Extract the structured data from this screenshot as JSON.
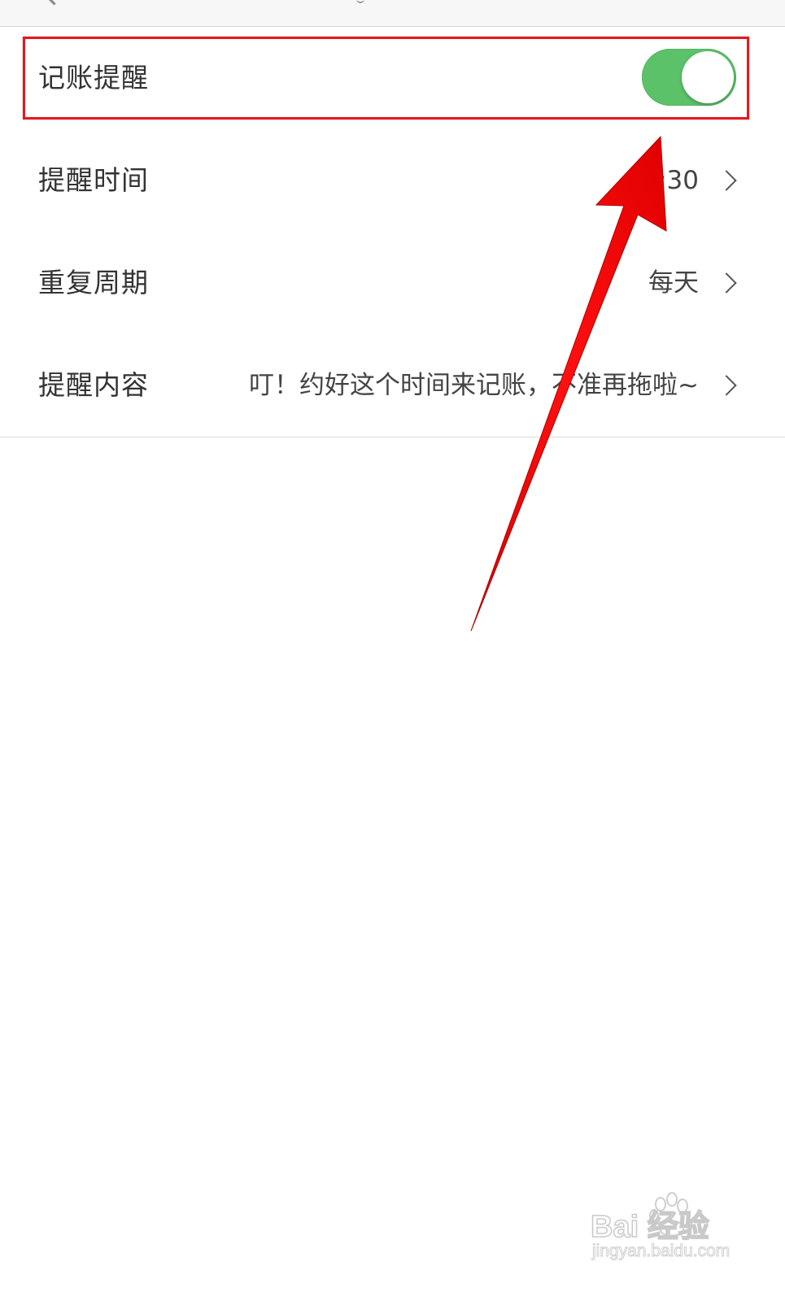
{
  "settings": {
    "rows": [
      {
        "label": "记账提醒",
        "toggle": {
          "on": true,
          "color": "#5cc26a"
        }
      },
      {
        "label": "提醒时间",
        "value": "19:30"
      },
      {
        "label": "重复周期",
        "value": "每天"
      },
      {
        "label": "提醒内容",
        "value": "叮！约好这个时间来记账，不准再拖啦~"
      }
    ]
  },
  "annotation": {
    "highlight_color": "#e8161c",
    "arrow_color": "#ff0000"
  },
  "icons": {
    "chevron": "chevron-right-icon",
    "back": "chevron-left-icon"
  },
  "watermark": {
    "brand": "Bai 经验",
    "url": "jingyan.baidu.com"
  }
}
